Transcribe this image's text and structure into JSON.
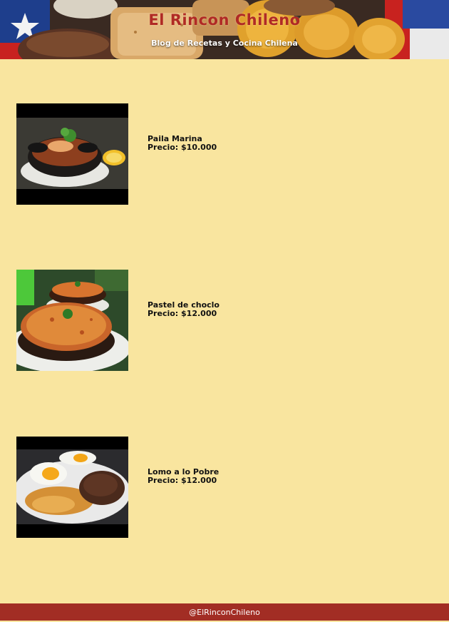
{
  "header": {
    "title": "El Rincon Chileno",
    "subtitle": "Blog de Recetas y Cocina Chilena"
  },
  "recipes": [
    {
      "name": "Paila Marina",
      "price": "Precio: $10.000",
      "image_icon": "paila-marina-photo"
    },
    {
      "name": "Pastel de choclo",
      "price": "Precio: $12.000",
      "image_icon": "pastel-de-choclo-photo"
    },
    {
      "name": "Lomo a lo Pobre",
      "price": "Precio: $12.000",
      "image_icon": "lomo-a-lo-pobre-photo"
    }
  ],
  "footer": {
    "handle": "@ElRinconChileno"
  },
  "colors": {
    "page_background": "#f9e59f",
    "title": "#b02a25",
    "footer_background": "#a22d24",
    "text": "#111111"
  }
}
